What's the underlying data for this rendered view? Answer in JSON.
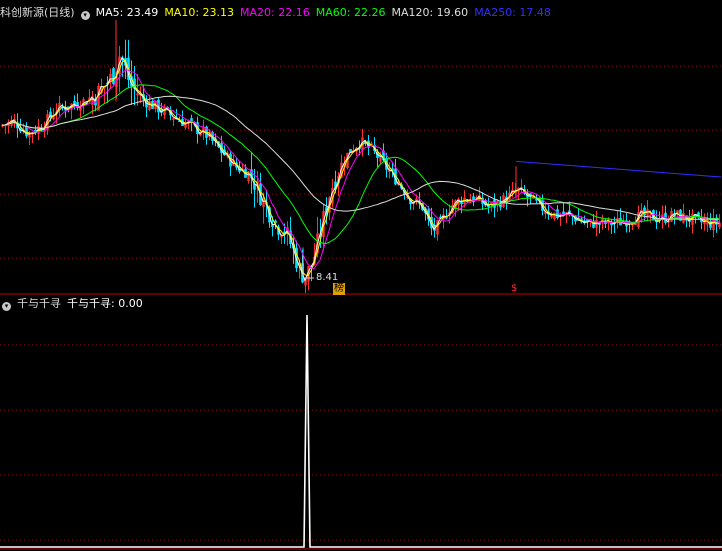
{
  "header": {
    "title": "科创新源(日线)",
    "ma": [
      {
        "label": "MA5: 23.49",
        "color": "#ffffff"
      },
      {
        "label": "MA10: 23.13",
        "color": "#ffff00"
      },
      {
        "label": "MA20: 22.16",
        "color": "#ff00ff"
      },
      {
        "label": "MA60: 22.26",
        "color": "#00ff00"
      },
      {
        "label": "MA120: 19.60",
        "color": "#dddddd"
      },
      {
        "label": "MA250: 17.48",
        "color": "#3030ff"
      }
    ]
  },
  "lower_header": {
    "name": "千与千寻",
    "value_label": "千与千寻: 0.00"
  },
  "annotations": {
    "low_price": "8.41",
    "badge1": "榜",
    "badge2": "$"
  },
  "colors": {
    "up": "#ff3030",
    "down": "#00e0ff",
    "divider": "#c00000",
    "grid": "#a00000",
    "signal": "#ffffff"
  },
  "chart_data": [
    {
      "type": "candlestick",
      "title": "科创新源(日线)",
      "y_range": [
        8.0,
        40.0
      ],
      "price_low_marked": 8.41,
      "series": [
        {
          "name": "MA5",
          "color": "#ffffff",
          "value": 23.49
        },
        {
          "name": "MA10",
          "color": "#ffff00",
          "value": 23.13
        },
        {
          "name": "MA20",
          "color": "#ff00ff",
          "value": 22.16
        },
        {
          "name": "MA60",
          "color": "#00ff00",
          "value": 22.26
        },
        {
          "name": "MA120",
          "color": "#dddddd",
          "value": 19.6
        },
        {
          "name": "MA250",
          "color": "#3030ff",
          "value": 17.48
        }
      ],
      "close_path": [
        [
          0,
          27
        ],
        [
          14,
          27.5
        ],
        [
          28,
          26
        ],
        [
          42,
          27
        ],
        [
          56,
          29
        ],
        [
          70,
          29.5
        ],
        [
          84,
          30
        ],
        [
          98,
          31
        ],
        [
          112,
          33
        ],
        [
          120,
          36
        ],
        [
          130,
          32
        ],
        [
          145,
          30
        ],
        [
          160,
          29
        ],
        [
          175,
          28
        ],
        [
          190,
          27
        ],
        [
          205,
          26
        ],
        [
          220,
          24
        ],
        [
          235,
          22
        ],
        [
          250,
          21
        ],
        [
          262,
          18
        ],
        [
          275,
          15
        ],
        [
          285,
          14
        ],
        [
          292,
          12
        ],
        [
          300,
          9
        ],
        [
          305,
          8.4
        ],
        [
          312,
          10
        ],
        [
          320,
          14
        ],
        [
          330,
          19
        ],
        [
          340,
          22
        ],
        [
          350,
          24
        ],
        [
          360,
          25
        ],
        [
          372,
          24
        ],
        [
          385,
          22
        ],
        [
          398,
          20
        ],
        [
          410,
          18
        ],
        [
          422,
          17
        ],
        [
          432,
          14
        ],
        [
          440,
          15
        ],
        [
          450,
          17
        ],
        [
          462,
          18
        ],
        [
          475,
          18
        ],
        [
          490,
          17
        ],
        [
          505,
          18
        ],
        [
          518,
          19
        ],
        [
          530,
          18
        ],
        [
          540,
          17
        ],
        [
          555,
          16
        ],
        [
          570,
          16
        ],
        [
          585,
          15
        ],
        [
          600,
          15
        ],
        [
          615,
          15
        ],
        [
          630,
          15.5
        ],
        [
          645,
          16
        ],
        [
          660,
          15.5
        ],
        [
          675,
          16
        ],
        [
          690,
          15.5
        ],
        [
          705,
          15
        ],
        [
          721,
          15
        ]
      ]
    },
    {
      "type": "line",
      "title": "千与千寻",
      "y_range": [
        0,
        1
      ],
      "value_last": 0.0,
      "spike": {
        "at": 307,
        "value": 1.0
      }
    }
  ]
}
